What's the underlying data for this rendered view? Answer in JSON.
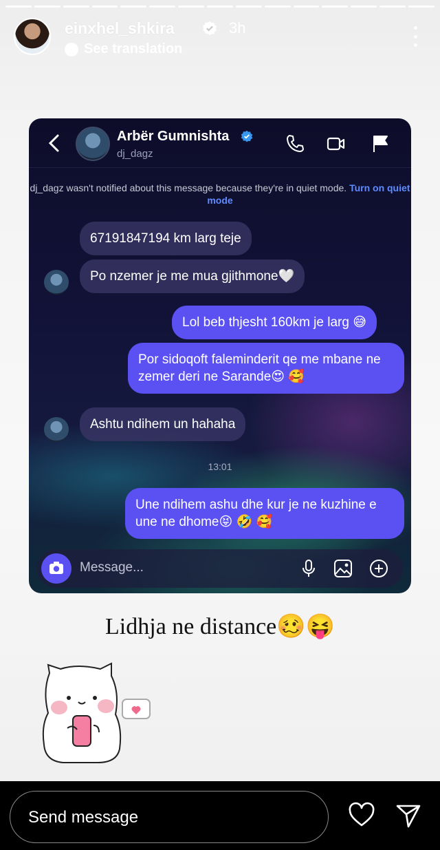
{
  "story": {
    "username": "einxhel_shkira",
    "time": "3h",
    "translate_label": "See translation",
    "progress_segments": 15
  },
  "chat": {
    "contact_name": "Arbër Gumnishta",
    "contact_handle": "dj_dagz",
    "notice_text": "dj_dagz wasn't notified about this message because they're in quiet mode.",
    "notice_link": "Turn on quiet mode",
    "messages": [
      {
        "dir": "in",
        "text": "67191847194 km larg teje"
      },
      {
        "dir": "in",
        "text": "Po nzemer je me mua gjithmone🤍"
      },
      {
        "dir": "out",
        "text": "Lol beb thjesht 160km je larg 😅"
      },
      {
        "dir": "out",
        "text": "Por sidoqoft faleminderit qe me mbane ne zemer deri ne Sarande😍 🥰"
      },
      {
        "dir": "in",
        "text": "Ashtu ndihem un hahaha"
      },
      {
        "dir": "out",
        "text": "Une ndihem ashu dhe kur je ne kuzhine e une ne dhome😝 🤣 🥰"
      }
    ],
    "timestamp": "13:01",
    "composer_placeholder": "Message..."
  },
  "caption": "Lidhja ne distance🥴😝",
  "reply": {
    "placeholder": "Send message"
  },
  "colors": {
    "outgoing_bubble": "#5b51f2",
    "incoming_bubble": "#38346a",
    "link": "#5e8bff",
    "verified": "#3897f0"
  }
}
